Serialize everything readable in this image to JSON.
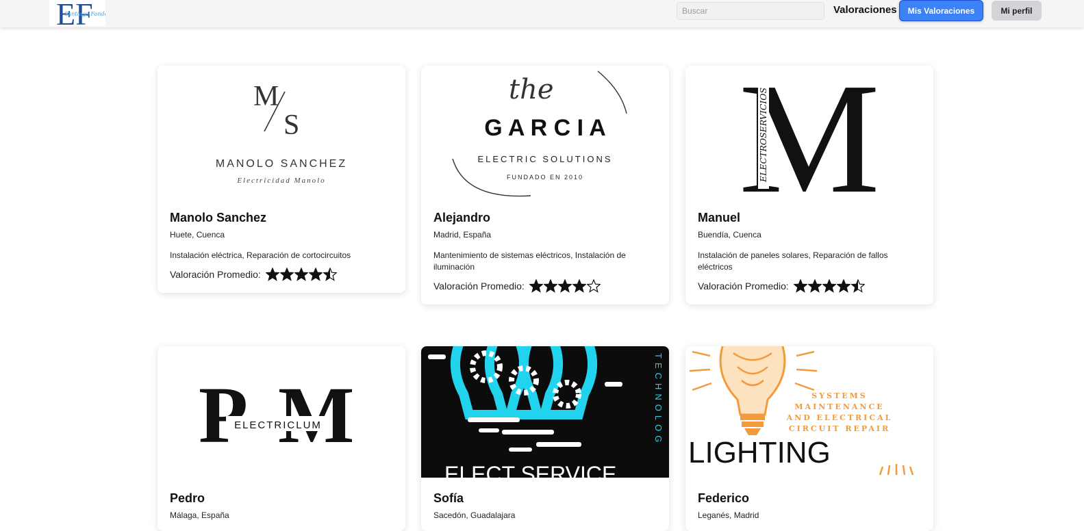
{
  "header": {
    "search_placeholder": "Buscar",
    "nav_link": "Valoraciones",
    "primary_button": "Mis Valoraciones",
    "profile_button": "Mi perfil",
    "accent_color": "#3b82f6"
  },
  "logo": {
    "letters": "EF",
    "script": "Santiago Fondo"
  },
  "cards": [
    {
      "name": "Manolo Sanchez",
      "location": "Huete, Cuenca",
      "services": "Instalación eléctrica, Reparación de cortocircuitos",
      "rating_label": "Valoración Promedio:",
      "rating": 4.5,
      "logo_text": {
        "initials_a": "M",
        "initials_b": "S",
        "title": "MANOLO SANCHEZ",
        "subtitle": "Electricidad Manolo"
      }
    },
    {
      "name": "Alejandro",
      "location": "Madrid, España",
      "services": "Mantenimiento de sistemas eléctricos, Instalación de iluminación",
      "rating_label": "Valoración Promedio:",
      "rating": 4,
      "logo_text": {
        "script": "the",
        "title": "G A R C I A",
        "subtitle": "ELECTRIC SOLUTIONS",
        "founded": "FUNDADO EN 2010"
      }
    },
    {
      "name": "Manuel",
      "location": "Buendía, Cuenca",
      "services": "Instalación de paneles solares, Reparación de fallos eléctricos",
      "rating_label": "Valoración Promedio:",
      "rating": 4.5,
      "logo_text": {
        "letter": "M",
        "vertical": "ELECTROSERVICIOS"
      }
    },
    {
      "name": "Pedro",
      "location": "Málaga, España",
      "services": "",
      "rating_label": "",
      "rating": null,
      "logo_text": {
        "letter_a": "P",
        "letter_b": "M",
        "band": "ELECTRICLUM"
      }
    },
    {
      "name": "Sofía",
      "location": "Sacedón, Guadalajara",
      "services": "",
      "rating_label": "",
      "rating": null,
      "logo_text": {
        "title": "ELECT SERVICE",
        "vertical": "TECHNOLOG"
      }
    },
    {
      "name": "Federico",
      "location": "Leganés, Madrid",
      "services": "",
      "rating_label": "",
      "rating": null,
      "logo_text": {
        "line1": "SYSTEMS",
        "line2": "MAINTENANCE",
        "line3": "AND ELECTRICAL",
        "line4": "CIRCUIT REPAIR",
        "title": "LIGHTING"
      }
    }
  ]
}
